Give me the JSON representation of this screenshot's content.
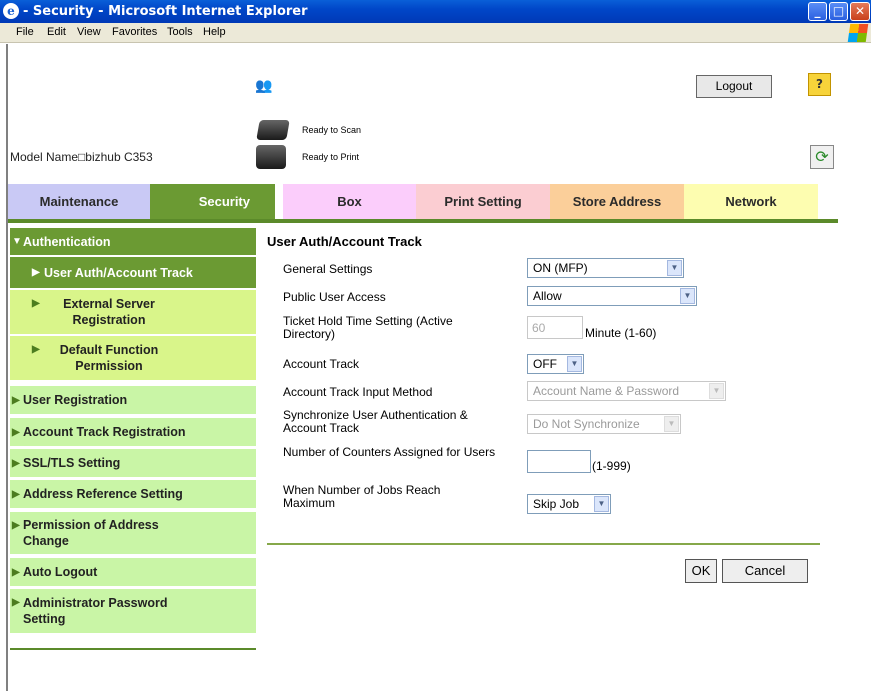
{
  "window": {
    "title": "- Security - Microsoft Internet Explorer",
    "min": "_",
    "max": "□",
    "close": "✕"
  },
  "menu": [
    "File",
    "Edit",
    "View",
    "Favorites",
    "Tools",
    "Help"
  ],
  "header": {
    "logout_label": "Logout",
    "help_symbol": "?",
    "model_name": "Model Name□bizhub C353",
    "scan_status": "Ready to Scan",
    "print_status": "Ready to Print"
  },
  "tabs": [
    {
      "label": "Maintenance",
      "color": "#c9c9f5"
    },
    {
      "label": "Security",
      "color": "#6b9a33",
      "active": true
    },
    {
      "label": "Box",
      "color": "#fbcdfb"
    },
    {
      "label": "Print Setting",
      "color": "#fbcdd2"
    },
    {
      "label": "Store Address",
      "color": "#fbcf9a"
    },
    {
      "label": "Network",
      "color": "#fdfdb0"
    }
  ],
  "sidebar": [
    {
      "label": "Authentication",
      "arrow": "▼"
    },
    {
      "label": "User Auth/Account Track",
      "arrow": "▶"
    },
    {
      "label": "External Server Registration",
      "arrow": "▶"
    },
    {
      "label": "Default Function Permission",
      "arrow": "▶"
    },
    {
      "label": "User Registration",
      "arrow": "▶"
    },
    {
      "label": "Account Track Registration",
      "arrow": "▶"
    },
    {
      "label": "SSL/TLS Setting",
      "arrow": "▶"
    },
    {
      "label": "Address Reference Setting",
      "arrow": "▶"
    },
    {
      "label": "Permission of Address Change",
      "arrow": "▶"
    },
    {
      "label": "Auto Logout",
      "arrow": "▶"
    },
    {
      "label": "Administrator Password Setting",
      "arrow": "▶"
    }
  ],
  "form": {
    "title": "User Auth/Account Track",
    "fields": [
      {
        "label": "General Settings",
        "value": "ON (MFP)"
      },
      {
        "label": "Public User Access",
        "value": "Allow"
      },
      {
        "label": "Ticket Hold Time Setting (Active Directory)",
        "value": "60",
        "unit": "Minute (1-60)"
      },
      {
        "label": "Account Track",
        "value": "OFF"
      },
      {
        "label": "Account Track Input Method",
        "value": "Account Name & Password"
      },
      {
        "label": "Synchronize User Authentication & Account Track",
        "value": "Do Not Synchronize"
      },
      {
        "label": "Number of Counters Assigned for Users",
        "value": "",
        "unit": "(1-999)"
      },
      {
        "label": "When Number of Jobs Reach Maximum",
        "value": "Skip Job"
      }
    ],
    "ok_label": "OK",
    "cancel_label": "Cancel",
    "dropdown_arrow": "▼"
  }
}
